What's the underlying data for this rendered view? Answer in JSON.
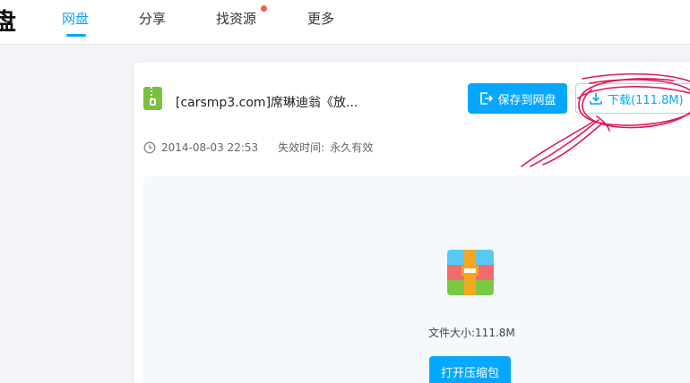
{
  "header": {
    "logo_fragment": "盘",
    "nav": [
      {
        "label": "网盘",
        "active": true
      },
      {
        "label": "分享",
        "active": false
      },
      {
        "label": "找资源",
        "active": false,
        "badge": true
      },
      {
        "label": "更多",
        "active": false
      }
    ]
  },
  "file": {
    "title": "[carsmp3.com]席琳迪翁《放...",
    "date": "2014-08-03 22:53",
    "expiry_label": "失效时间:",
    "expiry_value": "永久有效",
    "icon": "zip-file-icon"
  },
  "actions": {
    "save": "保存到网盘",
    "download": "下载(111.8M)",
    "open_archive": "打开压缩包"
  },
  "preview": {
    "size_label": "文件大小:111.8M",
    "icon": "archive-icon"
  },
  "colors": {
    "accent": "#06a7ff",
    "annotation": "#e0195a",
    "badge": "#f45c4d"
  }
}
